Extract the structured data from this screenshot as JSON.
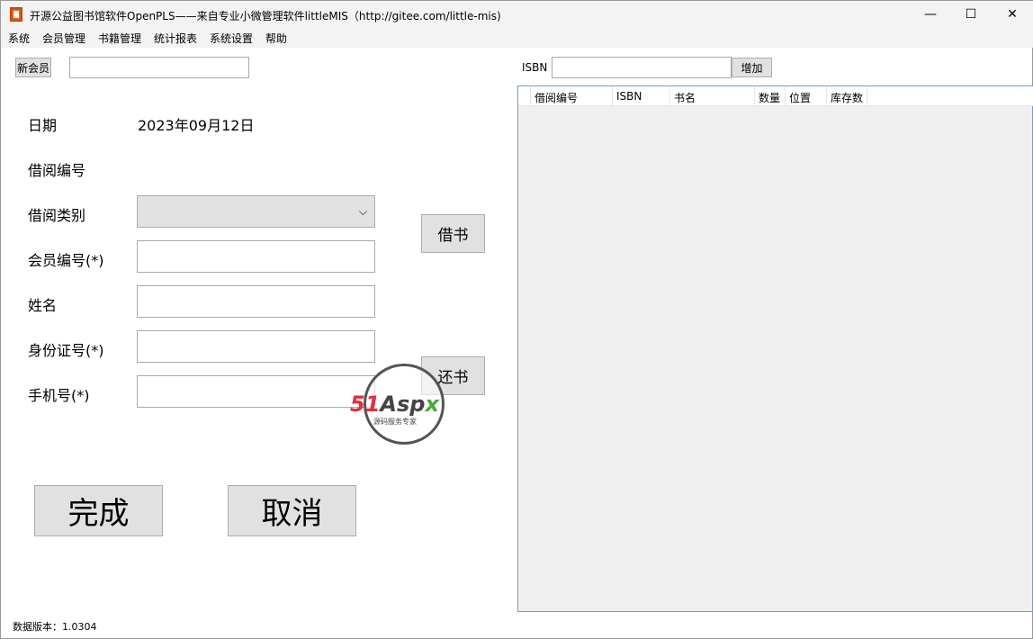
{
  "window": {
    "title": "开源公益图书馆软件OpenPLS——来自专业小微管理软件littleMIS（http://gitee.com/little-mis)",
    "minimize": "—",
    "maximize": "☐",
    "close": "✕"
  },
  "menu": [
    "系统",
    "会员管理",
    "书籍管理",
    "统计报表",
    "系统设置",
    "帮助"
  ],
  "new_member_button": "新会员",
  "new_member_input": "",
  "isbn": {
    "label": "ISBN",
    "value": "",
    "add_button": "增加"
  },
  "grid": {
    "columns": [
      "借阅编号",
      "ISBN",
      "书名",
      "数量",
      "位置",
      "库存数"
    ]
  },
  "form": {
    "date_label": "日期",
    "date_value": "2023年09月12日",
    "borrow_no_label": "借阅编号",
    "borrow_type_label": "借阅类别",
    "member_no_label": "会员编号(*)",
    "name_label": "姓名",
    "id_label": "身份证号(*)",
    "phone_label": "手机号(*)"
  },
  "buttons": {
    "borrow": "借书",
    "return": "还书",
    "done": "完成",
    "cancel": "取消"
  },
  "status": "数据版本：1.0304",
  "watermark": {
    "brand": "51Aspx",
    "tagline": "源码服务专家"
  }
}
